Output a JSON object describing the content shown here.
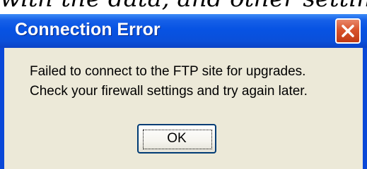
{
  "background_text": "with the data, and other settings",
  "dialog": {
    "title": "Connection Error",
    "close_icon": "close-x-icon",
    "message_lines": [
      "Failed to connect to the FTP site for upgrades.",
      "Check your firewall settings and try again later."
    ],
    "ok_label": "OK"
  },
  "colors": {
    "titlebar": "#0753e3",
    "frame": "#0a48d8",
    "client": "#ece9d8",
    "close_button": "#d8542c",
    "button_border": "#003c74"
  }
}
